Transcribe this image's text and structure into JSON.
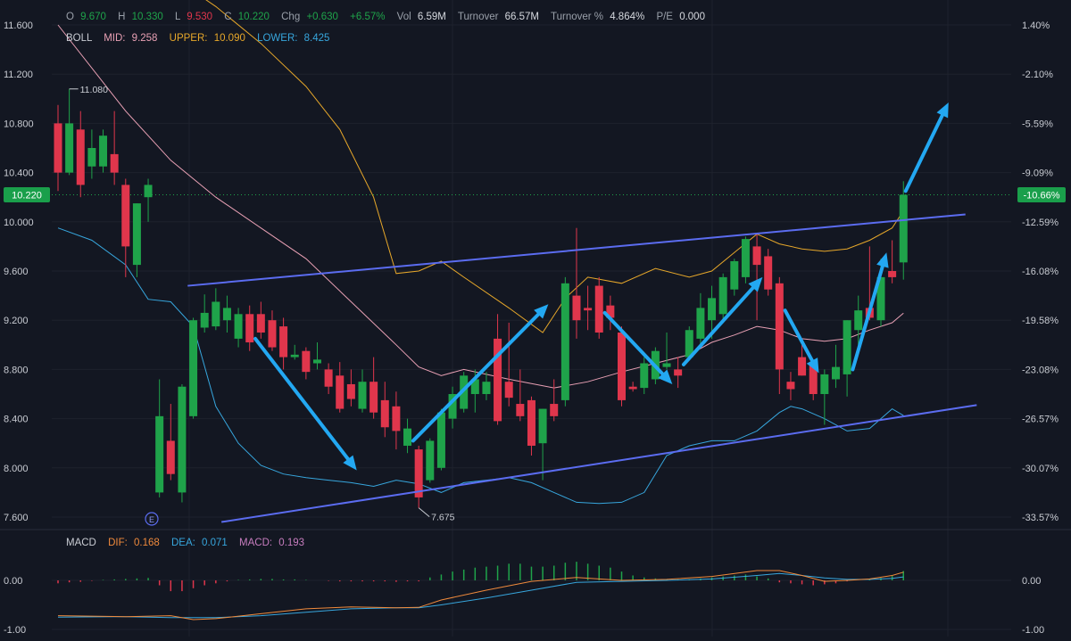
{
  "colors": {
    "background": "#131722",
    "grid": "#1e222d",
    "up": "#1fa34a",
    "down": "#e0364c",
    "boll_mid": "#e8a0b4",
    "boll_upper": "#e6a72a",
    "boll_lower": "#37a6dd",
    "trendline": "#5b6cf0",
    "arrow": "#23a8f2",
    "dif": "#f08a3c",
    "dea": "#37a6dd",
    "macd": "#c77dbf",
    "label": "#c9ccd3",
    "price_tag": "#1a9f4b"
  },
  "header": {
    "open_label": "O",
    "open_value": "9.670",
    "high_label": "H",
    "high_value": "10.330",
    "low_label": "L",
    "low_value": "9.530",
    "close_label": "C",
    "close_value": "10.220",
    "chg_label": "Chg",
    "chg_value": "+0.630",
    "chg_pct": "+6.57%",
    "vol_label": "Vol",
    "vol_value": "6.59M",
    "turnover_label": "Turnover",
    "turnover_value": "66.57M",
    "turnover_pct_label": "Turnover %",
    "turnover_pct_value": "4.864%",
    "pe_label": "P/E",
    "pe_value": "0.000"
  },
  "boll_legend": {
    "name": "BOLL",
    "mid_label": "MID:",
    "mid_value": "9.258",
    "upper_label": "UPPER:",
    "upper_value": "10.090",
    "lower_label": "LOWER:",
    "lower_value": "8.425"
  },
  "macd_legend": {
    "name": "MACD",
    "dif_label": "DIF:",
    "dif_value": "0.168",
    "dea_label": "DEA:",
    "dea_value": "0.071",
    "macd_label": "MACD:",
    "macd_value": "0.193"
  },
  "annotations": {
    "high_marker": "11.080",
    "low_marker": "7.675",
    "earnings_badge": "E",
    "last_price": "10.220",
    "last_pct": "-10.66%"
  },
  "chart_data": {
    "type": "candlestick",
    "price_axis": {
      "ticks": [
        "11.600",
        "11.200",
        "10.800",
        "10.400",
        "10.000",
        "9.600",
        "9.200",
        "8.800",
        "8.400",
        "8.000",
        "7.600"
      ],
      "range": [
        7.55,
        11.7
      ]
    },
    "pct_axis": {
      "ticks": [
        "1.40%",
        "-2.10%",
        "-5.59%",
        "-9.09%",
        "-12.59%",
        "-16.08%",
        "-19.58%",
        "-23.08%",
        "-26.57%",
        "-30.07%",
        "-33.57%"
      ]
    },
    "macd_axis": {
      "ticks": [
        "0.00",
        "-1.00"
      ],
      "range": [
        -1.1,
        0.55
      ]
    },
    "candles": [
      {
        "o": 10.8,
        "h": 10.95,
        "l": 10.25,
        "c": 10.4
      },
      {
        "o": 10.4,
        "h": 11.08,
        "l": 10.38,
        "c": 10.8
      },
      {
        "o": 10.75,
        "h": 10.9,
        "l": 10.2,
        "c": 10.3
      },
      {
        "o": 10.45,
        "h": 10.75,
        "l": 10.35,
        "c": 10.6
      },
      {
        "o": 10.45,
        "h": 10.75,
        "l": 10.4,
        "c": 10.7
      },
      {
        "o": 10.55,
        "h": 10.9,
        "l": 10.3,
        "c": 10.4
      },
      {
        "o": 10.3,
        "h": 10.35,
        "l": 9.55,
        "c": 9.8
      },
      {
        "o": 9.65,
        "h": 10.15,
        "l": 9.55,
        "c": 10.15
      },
      {
        "o": 10.2,
        "h": 10.35,
        "l": 10.0,
        "c": 10.3
      },
      {
        "o": 7.8,
        "h": 8.72,
        "l": 7.76,
        "c": 8.42
      },
      {
        "o": 8.22,
        "h": 8.52,
        "l": 7.9,
        "c": 7.95
      },
      {
        "o": 7.8,
        "h": 8.68,
        "l": 7.72,
        "c": 8.66
      },
      {
        "o": 8.42,
        "h": 9.22,
        "l": 8.4,
        "c": 9.2
      },
      {
        "o": 9.14,
        "h": 9.41,
        "l": 9.1,
        "c": 9.26
      },
      {
        "o": 9.15,
        "h": 9.46,
        "l": 9.12,
        "c": 9.35
      },
      {
        "o": 9.2,
        "h": 9.4,
        "l": 9.1,
        "c": 9.3
      },
      {
        "o": 9.05,
        "h": 9.3,
        "l": 8.98,
        "c": 9.25
      },
      {
        "o": 9.25,
        "h": 9.32,
        "l": 8.95,
        "c": 9.02
      },
      {
        "o": 9.25,
        "h": 9.35,
        "l": 9.05,
        "c": 9.1
      },
      {
        "o": 9.2,
        "h": 9.28,
        "l": 8.95,
        "c": 8.98
      },
      {
        "o": 9.15,
        "h": 9.22,
        "l": 8.8,
        "c": 8.9
      },
      {
        "o": 8.9,
        "h": 9.0,
        "l": 8.88,
        "c": 8.92
      },
      {
        "o": 8.95,
        "h": 8.98,
        "l": 8.72,
        "c": 8.78
      },
      {
        "o": 8.85,
        "h": 9.02,
        "l": 8.8,
        "c": 8.88
      },
      {
        "o": 8.8,
        "h": 8.85,
        "l": 8.6,
        "c": 8.66
      },
      {
        "o": 8.75,
        "h": 8.86,
        "l": 8.45,
        "c": 8.48
      },
      {
        "o": 8.68,
        "h": 8.8,
        "l": 8.5,
        "c": 8.56
      },
      {
        "o": 8.48,
        "h": 8.8,
        "l": 8.45,
        "c": 8.7
      },
      {
        "o": 8.7,
        "h": 8.9,
        "l": 8.4,
        "c": 8.45
      },
      {
        "o": 8.55,
        "h": 8.7,
        "l": 8.25,
        "c": 8.33
      },
      {
        "o": 8.5,
        "h": 8.62,
        "l": 8.15,
        "c": 8.3
      },
      {
        "o": 8.18,
        "h": 8.4,
        "l": 8.12,
        "c": 8.32
      },
      {
        "o": 8.15,
        "h": 8.18,
        "l": 7.675,
        "c": 7.76
      },
      {
        "o": 7.9,
        "h": 8.24,
        "l": 7.88,
        "c": 8.22
      },
      {
        "o": 8.0,
        "h": 8.48,
        "l": 7.98,
        "c": 8.45
      },
      {
        "o": 8.4,
        "h": 8.66,
        "l": 8.32,
        "c": 8.6
      },
      {
        "o": 8.48,
        "h": 8.78,
        "l": 8.45,
        "c": 8.75
      },
      {
        "o": 8.6,
        "h": 8.8,
        "l": 8.45,
        "c": 8.72
      },
      {
        "o": 8.6,
        "h": 8.78,
        "l": 8.55,
        "c": 8.7
      },
      {
        "o": 9.05,
        "h": 9.25,
        "l": 8.35,
        "c": 8.38
      },
      {
        "o": 8.7,
        "h": 9.18,
        "l": 8.5,
        "c": 8.57
      },
      {
        "o": 8.52,
        "h": 8.8,
        "l": 8.38,
        "c": 8.42
      },
      {
        "o": 8.55,
        "h": 8.58,
        "l": 8.1,
        "c": 8.18
      },
      {
        "o": 8.2,
        "h": 8.48,
        "l": 7.9,
        "c": 8.48
      },
      {
        "o": 8.52,
        "h": 8.72,
        "l": 8.38,
        "c": 8.42
      },
      {
        "o": 8.55,
        "h": 9.55,
        "l": 8.5,
        "c": 9.5
      },
      {
        "o": 9.4,
        "h": 9.95,
        "l": 9.05,
        "c": 9.2
      },
      {
        "o": 9.3,
        "h": 9.48,
        "l": 9.12,
        "c": 9.28
      },
      {
        "o": 9.48,
        "h": 9.55,
        "l": 9.05,
        "c": 9.1
      },
      {
        "o": 9.32,
        "h": 9.4,
        "l": 9.12,
        "c": 9.22
      },
      {
        "o": 9.1,
        "h": 9.15,
        "l": 8.5,
        "c": 8.55
      },
      {
        "o": 8.66,
        "h": 8.7,
        "l": 8.62,
        "c": 8.64
      },
      {
        "o": 8.65,
        "h": 8.9,
        "l": 8.6,
        "c": 8.85
      },
      {
        "o": 8.72,
        "h": 8.98,
        "l": 8.68,
        "c": 8.95
      },
      {
        "o": 8.82,
        "h": 9.1,
        "l": 8.8,
        "c": 8.85
      },
      {
        "o": 8.8,
        "h": 8.9,
        "l": 8.65,
        "c": 8.75
      },
      {
        "o": 8.9,
        "h": 9.15,
        "l": 8.88,
        "c": 9.12
      },
      {
        "o": 9.05,
        "h": 9.42,
        "l": 9.0,
        "c": 9.3
      },
      {
        "o": 9.2,
        "h": 9.48,
        "l": 9.05,
        "c": 9.38
      },
      {
        "o": 9.25,
        "h": 9.58,
        "l": 9.2,
        "c": 9.55
      },
      {
        "o": 9.45,
        "h": 9.7,
        "l": 9.4,
        "c": 9.68
      },
      {
        "o": 9.55,
        "h": 9.88,
        "l": 9.5,
        "c": 9.86
      },
      {
        "o": 9.8,
        "h": 9.9,
        "l": 9.2,
        "c": 9.65
      },
      {
        "o": 9.72,
        "h": 9.78,
        "l": 9.4,
        "c": 9.45
      },
      {
        "o": 9.5,
        "h": 9.55,
        "l": 8.6,
        "c": 8.8
      },
      {
        "o": 8.7,
        "h": 8.78,
        "l": 8.55,
        "c": 8.64
      },
      {
        "o": 8.9,
        "h": 9.0,
        "l": 8.75,
        "c": 8.75
      },
      {
        "o": 8.85,
        "h": 8.88,
        "l": 8.55,
        "c": 8.6
      },
      {
        "o": 8.6,
        "h": 8.8,
        "l": 8.35,
        "c": 8.76
      },
      {
        "o": 8.72,
        "h": 9.0,
        "l": 8.65,
        "c": 8.82
      },
      {
        "o": 8.76,
        "h": 9.2,
        "l": 8.58,
        "c": 9.2
      },
      {
        "o": 9.12,
        "h": 9.4,
        "l": 9.0,
        "c": 9.28
      },
      {
        "o": 9.3,
        "h": 9.8,
        "l": 9.2,
        "c": 9.22
      },
      {
        "o": 9.2,
        "h": 9.7,
        "l": 9.15,
        "c": 9.55
      },
      {
        "o": 9.6,
        "h": 9.85,
        "l": 9.5,
        "c": 9.55
      },
      {
        "o": 9.67,
        "h": 10.33,
        "l": 9.53,
        "c": 10.22
      }
    ],
    "boll_upper": [
      [
        0,
        12.35
      ],
      [
        10,
        12.0
      ],
      [
        14,
        11.75
      ],
      [
        18,
        11.45
      ],
      [
        22,
        11.1
      ],
      [
        25,
        10.75
      ],
      [
        28,
        10.2
      ],
      [
        30,
        9.58
      ],
      [
        32,
        9.6
      ],
      [
        34,
        9.68
      ],
      [
        36,
        9.55
      ],
      [
        40,
        9.3
      ],
      [
        43,
        9.1
      ],
      [
        45,
        9.38
      ],
      [
        47,
        9.55
      ],
      [
        50,
        9.5
      ],
      [
        53,
        9.62
      ],
      [
        56,
        9.55
      ],
      [
        58,
        9.6
      ],
      [
        60,
        9.75
      ],
      [
        62,
        9.9
      ],
      [
        64,
        9.82
      ],
      [
        66,
        9.78
      ],
      [
        68,
        9.76
      ],
      [
        70,
        9.78
      ],
      [
        72,
        9.85
      ],
      [
        74,
        9.95
      ],
      [
        75,
        10.09
      ]
    ],
    "boll_mid": [
      [
        0,
        11.6
      ],
      [
        6,
        10.9
      ],
      [
        10,
        10.5
      ],
      [
        14,
        10.2
      ],
      [
        18,
        9.95
      ],
      [
        22,
        9.7
      ],
      [
        26,
        9.35
      ],
      [
        30,
        9.0
      ],
      [
        32,
        8.82
      ],
      [
        34,
        8.75
      ],
      [
        36,
        8.8
      ],
      [
        40,
        8.72
      ],
      [
        44,
        8.65
      ],
      [
        47,
        8.7
      ],
      [
        50,
        8.78
      ],
      [
        53,
        8.85
      ],
      [
        56,
        8.92
      ],
      [
        58,
        9.02
      ],
      [
        60,
        9.08
      ],
      [
        62,
        9.15
      ],
      [
        64,
        9.12
      ],
      [
        66,
        9.05
      ],
      [
        68,
        9.03
      ],
      [
        70,
        9.05
      ],
      [
        72,
        9.12
      ],
      [
        74,
        9.18
      ],
      [
        75,
        9.258
      ]
    ],
    "boll_lower": [
      [
        0,
        9.95
      ],
      [
        3,
        9.85
      ],
      [
        6,
        9.65
      ],
      [
        8,
        9.37
      ],
      [
        10,
        9.35
      ],
      [
        12,
        9.15
      ],
      [
        14,
        8.5
      ],
      [
        16,
        8.2
      ],
      [
        18,
        8.02
      ],
      [
        20,
        7.95
      ],
      [
        22,
        7.92
      ],
      [
        24,
        7.9
      ],
      [
        26,
        7.88
      ],
      [
        28,
        7.85
      ],
      [
        30,
        7.9
      ],
      [
        32,
        7.87
      ],
      [
        34,
        7.8
      ],
      [
        36,
        7.88
      ],
      [
        38,
        7.9
      ],
      [
        40,
        7.92
      ],
      [
        42,
        7.88
      ],
      [
        44,
        7.8
      ],
      [
        46,
        7.72
      ],
      [
        48,
        7.71
      ],
      [
        50,
        7.72
      ],
      [
        52,
        7.8
      ],
      [
        54,
        8.1
      ],
      [
        56,
        8.18
      ],
      [
        58,
        8.22
      ],
      [
        60,
        8.22
      ],
      [
        62,
        8.3
      ],
      [
        64,
        8.45
      ],
      [
        65,
        8.5
      ],
      [
        66,
        8.48
      ],
      [
        68,
        8.4
      ],
      [
        70,
        8.3
      ],
      [
        72,
        8.32
      ],
      [
        74,
        8.48
      ],
      [
        75,
        8.425
      ]
    ],
    "trendlines": [
      {
        "points": [
          [
            11.5,
            9.48
          ],
          [
            80.5,
            10.06
          ]
        ]
      },
      {
        "points": [
          [
            14.5,
            7.56
          ],
          [
            81.5,
            8.51
          ]
        ]
      }
    ],
    "arrows": [
      {
        "from": [
          17.5,
          9.05
        ],
        "to": [
          26.5,
          7.98
        ]
      },
      {
        "from": [
          31.5,
          8.22
        ],
        "to": [
          43.5,
          9.33
        ]
      },
      {
        "from": [
          48.5,
          9.26
        ],
        "to": [
          54.5,
          8.68
        ]
      },
      {
        "from": [
          55.5,
          8.84
        ],
        "to": [
          62.5,
          9.55
        ]
      },
      {
        "from": [
          64.5,
          9.28
        ],
        "to": [
          67.5,
          8.77
        ]
      },
      {
        "from": [
          70.5,
          8.8
        ],
        "to": [
          73.5,
          9.75
        ]
      },
      {
        "from": [
          75.2,
          10.25
        ],
        "to": [
          79,
          10.97
        ]
      }
    ],
    "dif": [
      [
        0,
        -0.72
      ],
      [
        6,
        -0.74
      ],
      [
        10,
        -0.72
      ],
      [
        12,
        -0.8
      ],
      [
        14,
        -0.78
      ],
      [
        18,
        -0.68
      ],
      [
        22,
        -0.58
      ],
      [
        26,
        -0.54
      ],
      [
        30,
        -0.56
      ],
      [
        32,
        -0.55
      ],
      [
        34,
        -0.4
      ],
      [
        38,
        -0.2
      ],
      [
        42,
        -0.02
      ],
      [
        46,
        0.06
      ],
      [
        50,
        0.0
      ],
      [
        54,
        0.02
      ],
      [
        58,
        0.08
      ],
      [
        62,
        0.2
      ],
      [
        64,
        0.2
      ],
      [
        66,
        0.1
      ],
      [
        68,
        -0.02
      ],
      [
        70,
        0.0
      ],
      [
        72,
        0.03
      ],
      [
        74,
        0.1
      ],
      [
        75,
        0.168
      ]
    ],
    "dea": [
      [
        0,
        -0.75
      ],
      [
        6,
        -0.74
      ],
      [
        10,
        -0.76
      ],
      [
        14,
        -0.76
      ],
      [
        18,
        -0.72
      ],
      [
        22,
        -0.65
      ],
      [
        26,
        -0.58
      ],
      [
        30,
        -0.56
      ],
      [
        32,
        -0.56
      ],
      [
        34,
        -0.5
      ],
      [
        38,
        -0.36
      ],
      [
        42,
        -0.2
      ],
      [
        46,
        -0.04
      ],
      [
        50,
        -0.02
      ],
      [
        54,
        0.0
      ],
      [
        58,
        0.03
      ],
      [
        62,
        0.1
      ],
      [
        64,
        0.14
      ],
      [
        66,
        0.1
      ],
      [
        68,
        0.05
      ],
      [
        70,
        0.02
      ],
      [
        72,
        0.02
      ],
      [
        74,
        0.04
      ],
      [
        75,
        0.071
      ]
    ],
    "macd_hist": [
      -0.06,
      -0.04,
      -0.03,
      -0.01,
      0.01,
      0.02,
      0.03,
      0.04,
      0.05,
      -0.1,
      -0.22,
      -0.22,
      -0.16,
      -0.1,
      -0.06,
      -0.02,
      0.01,
      0.02,
      0.03,
      0.03,
      0.02,
      0.02,
      0.01,
      0.0,
      -0.01,
      -0.02,
      -0.02,
      -0.02,
      -0.02,
      -0.02,
      -0.03,
      -0.02,
      -0.02,
      0.06,
      0.12,
      0.18,
      0.22,
      0.26,
      0.28,
      0.3,
      0.34,
      0.34,
      0.28,
      0.28,
      0.3,
      0.36,
      0.38,
      0.34,
      0.3,
      0.26,
      0.18,
      0.1,
      0.06,
      0.04,
      0.02,
      0.02,
      0.02,
      0.04,
      0.06,
      0.08,
      0.1,
      0.12,
      0.08,
      0.04,
      -0.04,
      -0.06,
      -0.08,
      -0.1,
      -0.08,
      -0.06,
      -0.02,
      0.0,
      0.02,
      0.05,
      0.09,
      0.19
    ]
  }
}
